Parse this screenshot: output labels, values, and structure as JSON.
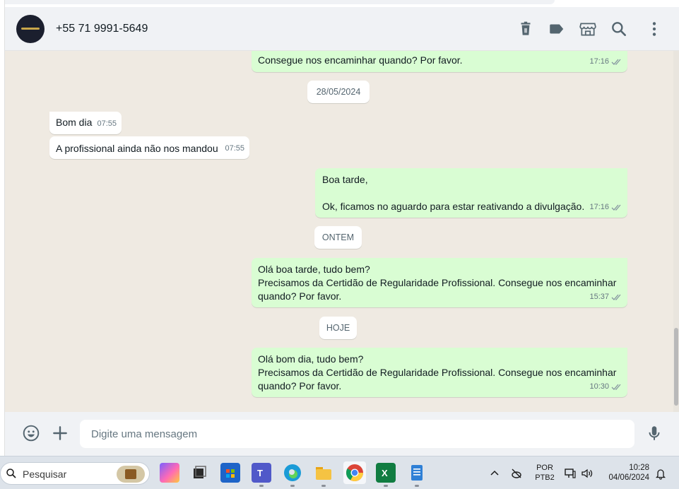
{
  "header": {
    "contact_name": "+55 71 9991-5649"
  },
  "messages": [
    {
      "kind": "out",
      "text": "Consegue nos encaminhar quando? Por favor.",
      "time": "17:16"
    },
    {
      "kind": "date",
      "label": "28/05/2024"
    },
    {
      "kind": "in",
      "text": "Bom dia",
      "time": "07:55"
    },
    {
      "kind": "in",
      "text": "A profissional ainda não nos mandou",
      "time": "07:55"
    },
    {
      "kind": "out",
      "text": "Boa tarde,\n\nOk, ficamos no aguardo para estar reativando a divulgação.",
      "time": "17:16"
    },
    {
      "kind": "date",
      "label": "ONTEM"
    },
    {
      "kind": "out",
      "text": "Olá boa tarde, tudo bem?\nPrecisamos da Certidão de Regularidade Profissional. Consegue nos encaminhar\nquando? Por favor.",
      "time": "15:37"
    },
    {
      "kind": "date",
      "label": "HOJE"
    },
    {
      "kind": "out",
      "text": "Olá bom dia, tudo bem?\nPrecisamos da Certidão de Regularidade Profissional. Consegue nos encaminhar\nquando? Por favor.",
      "time": "10:30"
    }
  ],
  "composer": {
    "placeholder": "Digite uma mensagem"
  },
  "taskbar": {
    "search_label": "Pesquisar",
    "lang_top": "POR",
    "lang_bottom": "PTB2",
    "time": "10:28",
    "date": "04/06/2024"
  },
  "colors": {
    "outgoing_bubble": "#d9fdd3",
    "incoming_bubble": "#ffffff",
    "chat_background": "#efeae2",
    "read_ticks": "#8696a0"
  }
}
